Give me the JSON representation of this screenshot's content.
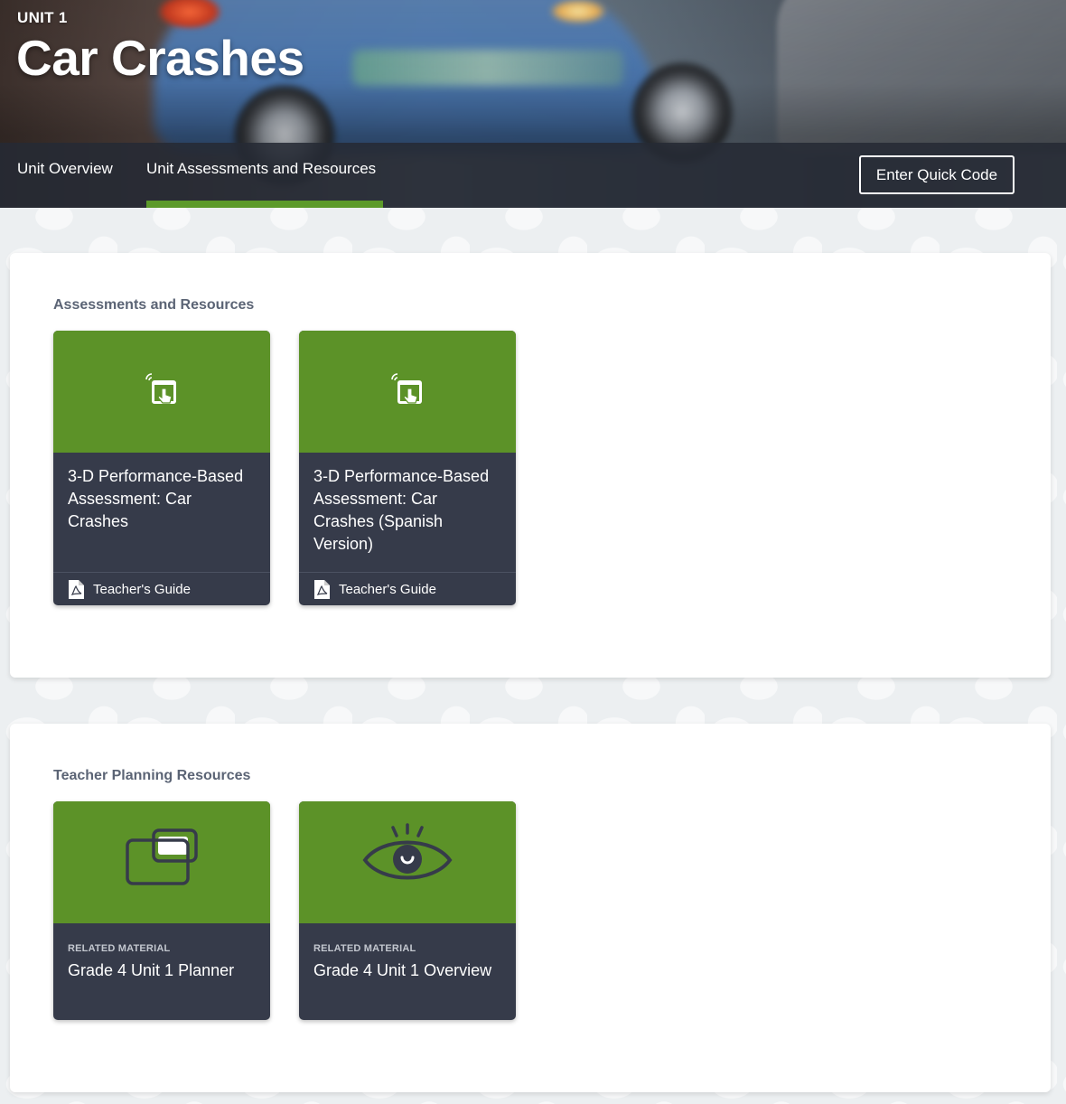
{
  "hero": {
    "kicker": "UNIT 1",
    "title": "Car Crashes"
  },
  "nav": {
    "tabs": [
      {
        "label": "Unit Overview",
        "active": false
      },
      {
        "label": "Unit Assessments and Resources",
        "active": true
      }
    ],
    "quick_code_label": "Enter Quick Code",
    "accent_color": "#5c9a2a"
  },
  "sections": [
    {
      "heading": "Assessments and Resources",
      "cards": [
        {
          "icon": "touch-device-icon",
          "title": "3-D Performance-Based Assessment: Car Crashes",
          "footer": {
            "icon": "pdf-icon",
            "label": "Teacher's Guide"
          }
        },
        {
          "icon": "touch-device-icon",
          "title": "3-D Performance-Based Assessment: Car Crashes (Spanish Version)",
          "footer": {
            "icon": "pdf-icon",
            "label": "Teacher's Guide"
          }
        }
      ]
    },
    {
      "heading": "Teacher Planning Resources",
      "cards": [
        {
          "icon": "overlapping-windows-icon",
          "kicker": "RELATED MATERIAL",
          "title": "Grade 4 Unit 1 Planner"
        },
        {
          "icon": "eye-icon",
          "kicker": "RELATED MATERIAL",
          "title": "Grade 4 Unit 1 Overview"
        }
      ]
    }
  ],
  "colors": {
    "card_top": "#5c9228",
    "card_body": "#363b4a",
    "heading": "#5b6475"
  }
}
